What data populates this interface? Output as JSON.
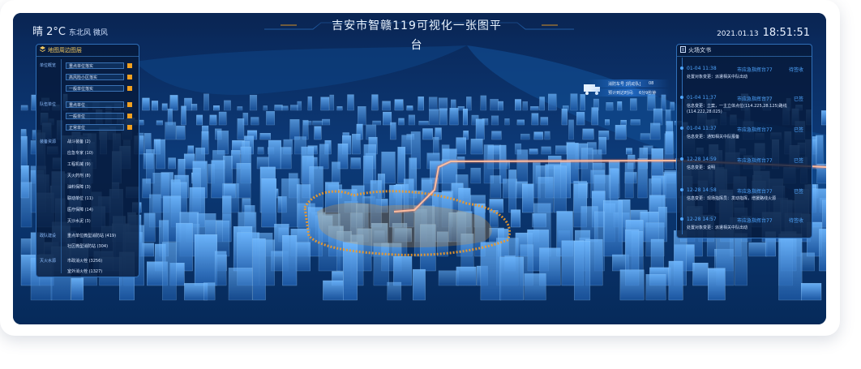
{
  "header": {
    "weather": "晴 2°C",
    "wind": "东北风 微风",
    "title": "吉安市智赣119可视化一张图平台",
    "date": "2021.01.13",
    "time": "18:51:51"
  },
  "left_panel": {
    "title": "地图周边图层",
    "categories": [
      {
        "label": "单位概览",
        "layers": [
          "重点单位落实",
          "高风险小区落实",
          "一般单位落实"
        ]
      },
      {
        "label": "队伍单位",
        "layers": [
          "重点单位",
          "一般单位",
          "正常单位"
        ]
      },
      {
        "label": "装备资源",
        "items": [
          "战斗装备 (2)",
          "应急专家 (10)",
          "工程机械 (9)",
          "灭火药剂 (8)",
          "油料保障 (3)",
          "联动单位 (11)",
          "医疗保障 (14)",
          "灭沙水泥 (3)"
        ]
      },
      {
        "label": "政队建设",
        "items": [
          "重点单位微型消防站 (419)",
          "社区微型消防站 (304)"
        ]
      },
      {
        "label": "灭火水源",
        "items": [
          "市政消火栓 (3256)",
          "室外消火栓 (1327)"
        ]
      }
    ]
  },
  "right_panel": {
    "title": "火场文书",
    "events": [
      {
        "time": "01-04 11:38",
        "source": "市应急指挥台77",
        "status": "待签收",
        "content": "处置对象变更：派遣相关中队出动"
      },
      {
        "time": "01-04 11:37",
        "source": "市应急指挥台77",
        "status": "已签",
        "content": "信息变更：立案，一主立体点位(114.225,28.125)路线(114.222,28.025)"
      },
      {
        "time": "01-04 11:37",
        "source": "市应急指挥台77",
        "status": "已签",
        "content": "信息变更：通知相关中队报备"
      },
      {
        "time": "12-28 14:59",
        "source": "市应急指挥台77",
        "status": "已签",
        "content": "信息变更：说明"
      },
      {
        "time": "12-28 14:58",
        "source": "市应急指挥台77",
        "status": "已签",
        "content": "信息变更：现场指挥员：发动指挥，增援路线火源"
      },
      {
        "time": "12-28 14:57",
        "source": "市应急指挥台77",
        "status": "待签收",
        "content": "处置对象变更：派遣相关中队出动"
      }
    ]
  },
  "vehicle_info": {
    "line1_label": "消防车号 [机动队]",
    "line1_value": "08",
    "line2_label": "预计到达时间:",
    "line2_value": "6分9秒钟"
  },
  "colors": {
    "accent": "#4fa6ff",
    "highlight": "#f0a020",
    "route": "#ffd8c0"
  }
}
